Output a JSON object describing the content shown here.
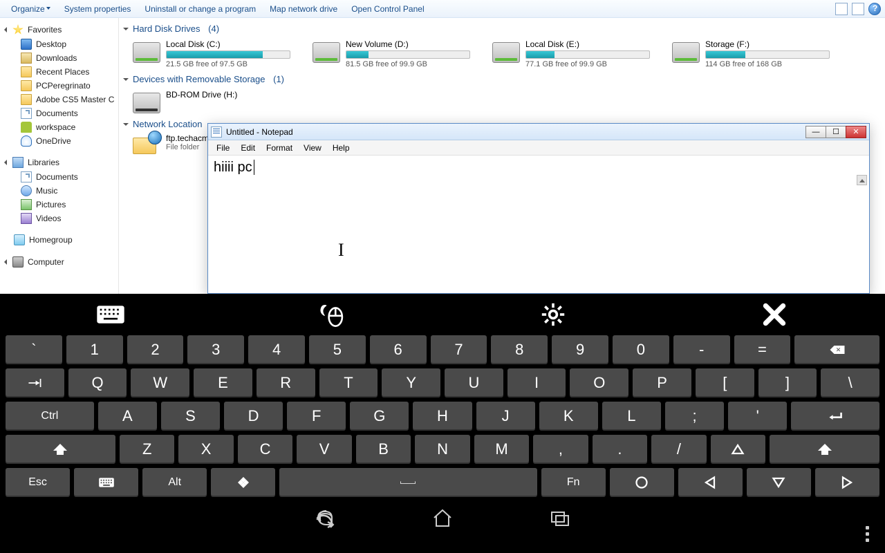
{
  "toolbar": {
    "organize": "Organize",
    "system_props": "System properties",
    "uninstall": "Uninstall or change a program",
    "map_drive": "Map network drive",
    "control_panel": "Open Control Panel"
  },
  "nav": {
    "favorites": "Favorites",
    "fav_items": [
      "Desktop",
      "Downloads",
      "Recent Places",
      "PCPeregrinato",
      "Adobe CS5 Master C",
      "Documents",
      "workspace",
      "OneDrive"
    ],
    "libraries": "Libraries",
    "lib_items": [
      "Documents",
      "Music",
      "Pictures",
      "Videos"
    ],
    "homegroup": "Homegroup",
    "computer": "Computer"
  },
  "sections": {
    "hdd": {
      "label": "Hard Disk Drives",
      "count": "(4)"
    },
    "removable": {
      "label": "Devices with Removable Storage",
      "count": "(1)"
    },
    "network": {
      "label": "Network Location",
      "count": ""
    }
  },
  "drives": [
    {
      "name": "Local Disk (C:)",
      "free": "21.5 GB free of 97.5 GB",
      "fill": 78
    },
    {
      "name": "New Volume (D:)",
      "free": "81.5 GB free of 99.9 GB",
      "fill": 18
    },
    {
      "name": "Local Disk (E:)",
      "free": "77.1 GB free of 99.9 GB",
      "fill": 23
    },
    {
      "name": "Storage (F:)",
      "free": "114 GB free of 168 GB",
      "fill": 32
    }
  ],
  "bd_drive": "BD-ROM Drive (H:)",
  "net_loc": {
    "name": "ftp.techacme",
    "sub": "File folder"
  },
  "notepad": {
    "title": "Untitled - Notepad",
    "menu": [
      "File",
      "Edit",
      "Format",
      "View",
      "Help"
    ],
    "text": "hiiii pc"
  },
  "keyboard": {
    "row_num": [
      "1",
      "2",
      "3",
      "4",
      "5",
      "6",
      "7",
      "8",
      "9",
      "0",
      "-",
      "="
    ],
    "row_q": [
      "Q",
      "W",
      "E",
      "R",
      "T",
      "Y",
      "U",
      "I",
      "O",
      "P",
      "[",
      "]",
      "\\"
    ],
    "row_a": [
      "A",
      "S",
      "D",
      "F",
      "G",
      "H",
      "J",
      "K",
      "L",
      ";",
      "'"
    ],
    "row_z": [
      "Z",
      "X",
      "C",
      "V",
      "B",
      "N",
      "M",
      ",",
      ".",
      "/"
    ],
    "ctrl": "Ctrl",
    "esc": "Esc",
    "alt": "Alt",
    "fn": "Fn"
  }
}
